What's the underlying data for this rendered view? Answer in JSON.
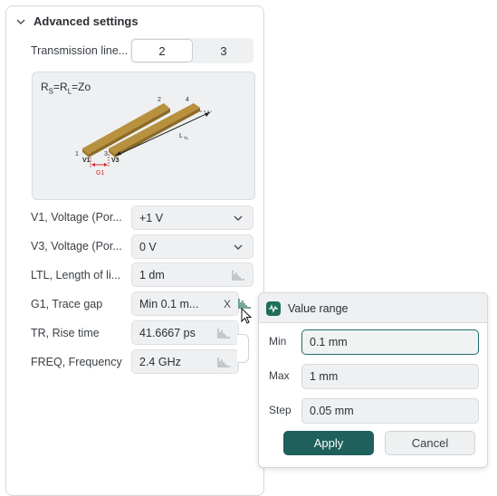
{
  "section": {
    "title": "Advanced settings"
  },
  "transmission": {
    "label": "Transmission line...",
    "options": [
      "2",
      "3"
    ],
    "selected": "2"
  },
  "diagram": {
    "formula_rs": "R",
    "formula_s": "S",
    "formula_rl": "=R",
    "formula_l": "L",
    "formula_end": "=Zo",
    "labels": {
      "n1": "1",
      "n2": "2",
      "n3": "3",
      "n4": "4",
      "v1": "V1",
      "v3": "V3",
      "g1": "G1",
      "ltl": "L",
      "ltl_sub": "TL"
    }
  },
  "fields": {
    "v1": {
      "label": "V1, Voltage (Por...",
      "value": "+1 V"
    },
    "v3": {
      "label": "V3, Voltage (Por...",
      "value": "0 V"
    },
    "ltl": {
      "label": "LTL, Length of li...",
      "value": "1 dm"
    },
    "g1": {
      "label": "G1, Trace gap",
      "value": "Min 0.1 m...",
      "clear": "X"
    },
    "tr": {
      "label": "TR, Rise time",
      "value": "41.6667 ps"
    },
    "freq": {
      "label": "FREQ, Frequency",
      "value": "2.4 GHz"
    }
  },
  "popup": {
    "title": "Value range",
    "min_label": "Min",
    "min_value": "0.1 mm",
    "max_label": "Max",
    "max_value": "1 mm",
    "step_label": "Step",
    "step_value": "0.05 mm",
    "apply": "Apply",
    "cancel": "Cancel"
  },
  "colors": {
    "accent": "#1f5f5c",
    "trace": "#b8913e",
    "gap_marker": "#d0262d"
  }
}
